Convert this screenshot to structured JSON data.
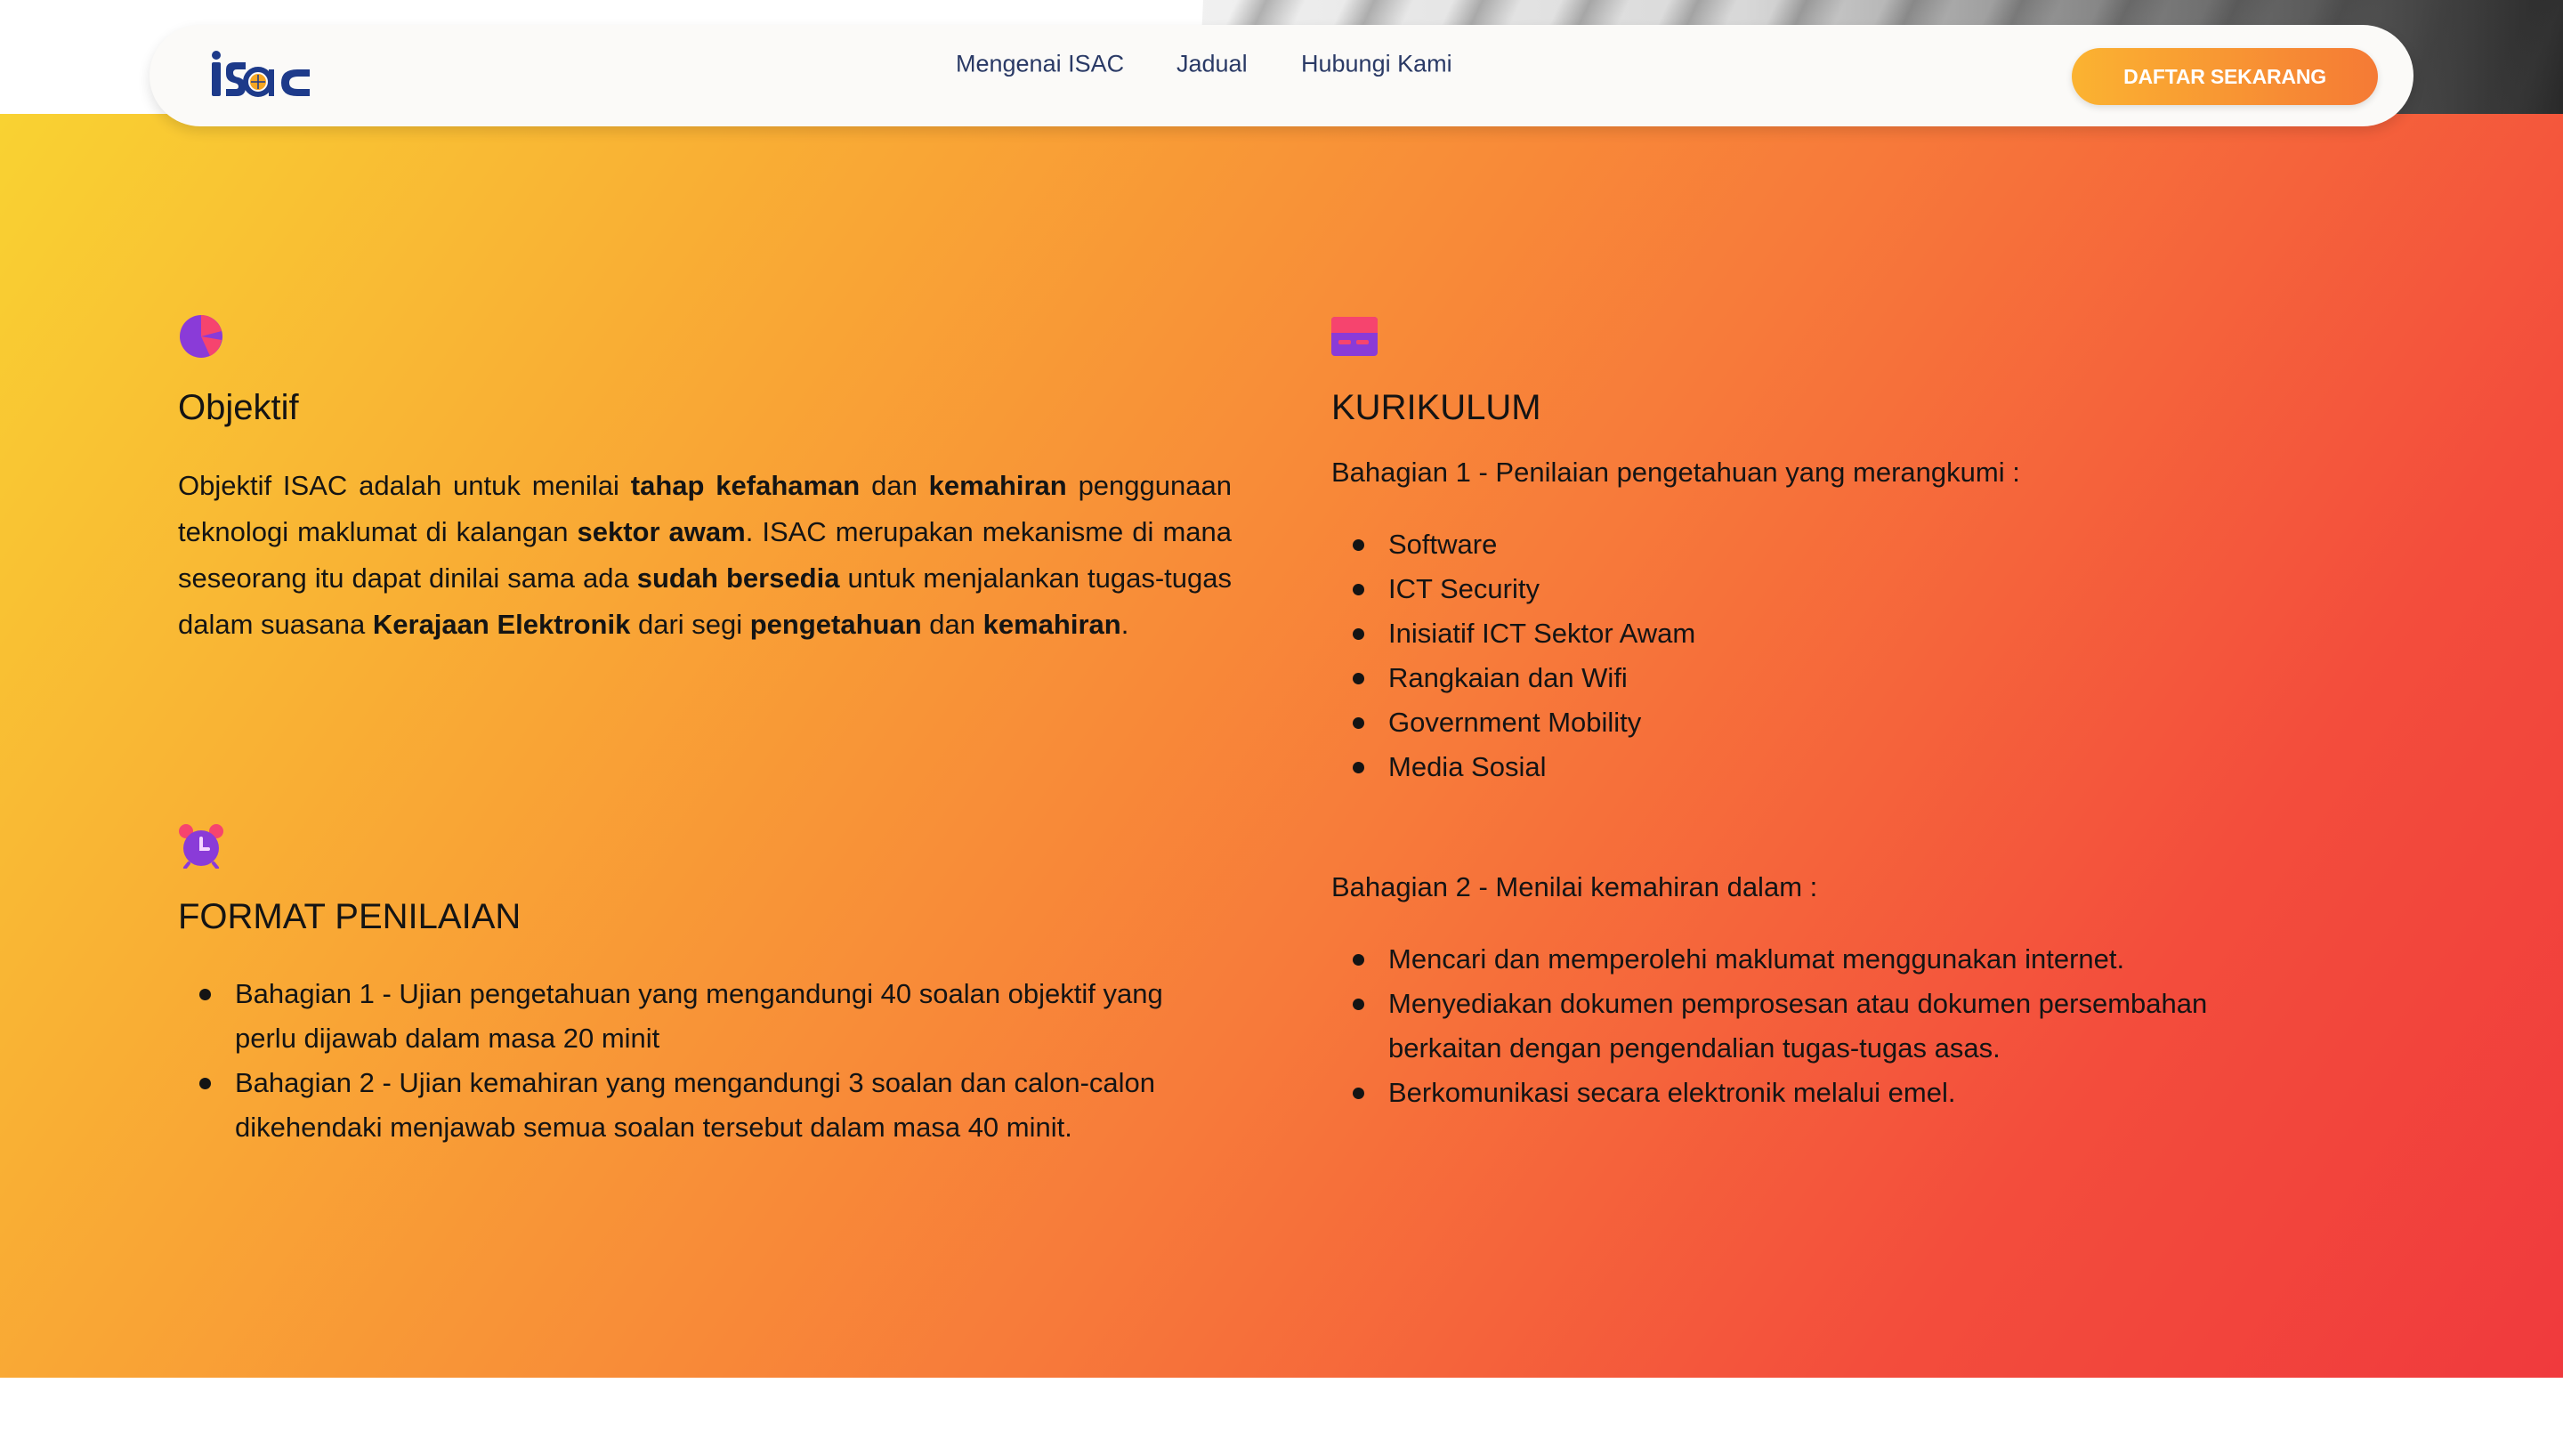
{
  "brand": {
    "logo_text": "isac",
    "accent_blue": "#1d3a8a",
    "accent_orange": "#f5a623"
  },
  "nav": {
    "links": [
      "Mengenai ISAC",
      "Jadual",
      "Hubungi Kami"
    ],
    "cta_label": "DAFTAR SEKARANG"
  },
  "objektif": {
    "icon": "pie-chart-icon",
    "title": "Objektif",
    "paragraph": [
      {
        "t": "Objektif ISAC adalah untuk menilai ",
        "b": false
      },
      {
        "t": "tahap kefahaman",
        "b": true
      },
      {
        "t": " dan ",
        "b": false
      },
      {
        "t": "kemahiran",
        "b": true
      },
      {
        "t": " penggunaan teknologi maklumat di kalangan ",
        "b": false
      },
      {
        "t": "sektor awam",
        "b": true
      },
      {
        "t": ". ISAC merupakan mekanisme di mana seseorang itu dapat dinilai sama ada ",
        "b": false
      },
      {
        "t": "sudah bersedia",
        "b": true
      },
      {
        "t": " untuk menjalankan tugas-tugas dalam suasana ",
        "b": false
      },
      {
        "t": "Kerajaan Elektronik",
        "b": true
      },
      {
        "t": " dari segi ",
        "b": false
      },
      {
        "t": "pengetahuan",
        "b": true
      },
      {
        "t": " dan ",
        "b": false
      },
      {
        "t": "kemahiran",
        "b": true
      },
      {
        "t": ".",
        "b": false
      }
    ]
  },
  "format": {
    "icon": "alarm-clock-icon",
    "title": "FORMAT PENILAIAN",
    "items": [
      "Bahagian 1 - Ujian pengetahuan yang mengandungi 40 soalan objektif yang perlu dijawab dalam masa 20 minit",
      "Bahagian 2 - Ujian kemahiran yang mengandungi 3 soalan dan calon-calon dikehendaki menjawab semua soalan tersebut dalam masa 40 minit."
    ]
  },
  "kurikulum": {
    "icon": "credit-card-icon",
    "title": "KURIKULUM",
    "part1_intro": "Bahagian 1 - Penilaian pengetahuan yang merangkumi :",
    "part1_items": [
      "Software",
      "ICT Security",
      "Inisiatif ICT Sektor Awam",
      "Rangkaian dan Wifi",
      "Government Mobility",
      "Media Sosial"
    ],
    "part2_intro": "Bahagian 2 - Menilai kemahiran dalam :",
    "part2_items": [
      "Mencari dan memperolehi maklumat menggunakan internet.",
      "Menyediakan dokumen pemprosesan atau dokumen persembahan berkaitan dengan pengendalian tugas-tugas asas.",
      "Berkomunikasi secara elektronik melalui emel."
    ]
  }
}
